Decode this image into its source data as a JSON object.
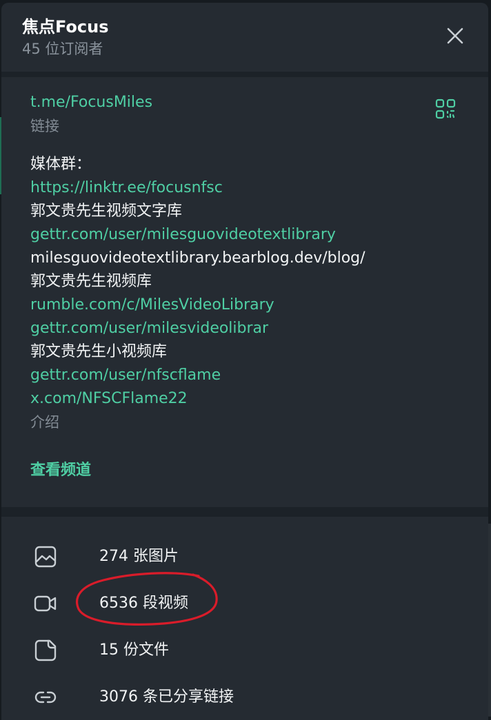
{
  "channel": {
    "title": "焦点Focus",
    "subscribers": "45 位订阅者"
  },
  "info": {
    "link": "t.me/FocusMiles",
    "link_label": "链接",
    "description_lines": [
      {
        "text": "媒体群：",
        "kind": "text"
      },
      {
        "text": "https://linktr.ee/focusnfsc",
        "kind": "link"
      },
      {
        "text": "郭文贵先生视频文字库",
        "kind": "text"
      },
      {
        "text": "gettr.com/user/milesguovideotextlibrary",
        "kind": "link"
      },
      {
        "text": "milesguovideotextlibrary.bearblog.dev/blog/",
        "kind": "text"
      },
      {
        "text": "郭文贵先生视频库",
        "kind": "text"
      },
      {
        "text": "rumble.com/c/MilesVideoLibrary",
        "kind": "link"
      },
      {
        "text": "gettr.com/user/milesvideolibrar",
        "kind": "link"
      },
      {
        "text": "郭文贵先生小视频库",
        "kind": "text"
      },
      {
        "text": "gettr.com/user/nfscflame",
        "kind": "link"
      },
      {
        "text": "x.com/NFSCFlame22",
        "kind": "link"
      }
    ],
    "description_label": "介绍",
    "view_channel": "查看频道"
  },
  "media": [
    {
      "icon": "image-icon",
      "label": "274 张图片"
    },
    {
      "icon": "video-icon",
      "label": "6536 段视频"
    },
    {
      "icon": "file-icon",
      "label": "15 份文件"
    },
    {
      "icon": "link-icon",
      "label": "3076 条已分享链接"
    }
  ],
  "colors": {
    "accent": "#4fcfa4",
    "annotation": "#d91c2a"
  }
}
